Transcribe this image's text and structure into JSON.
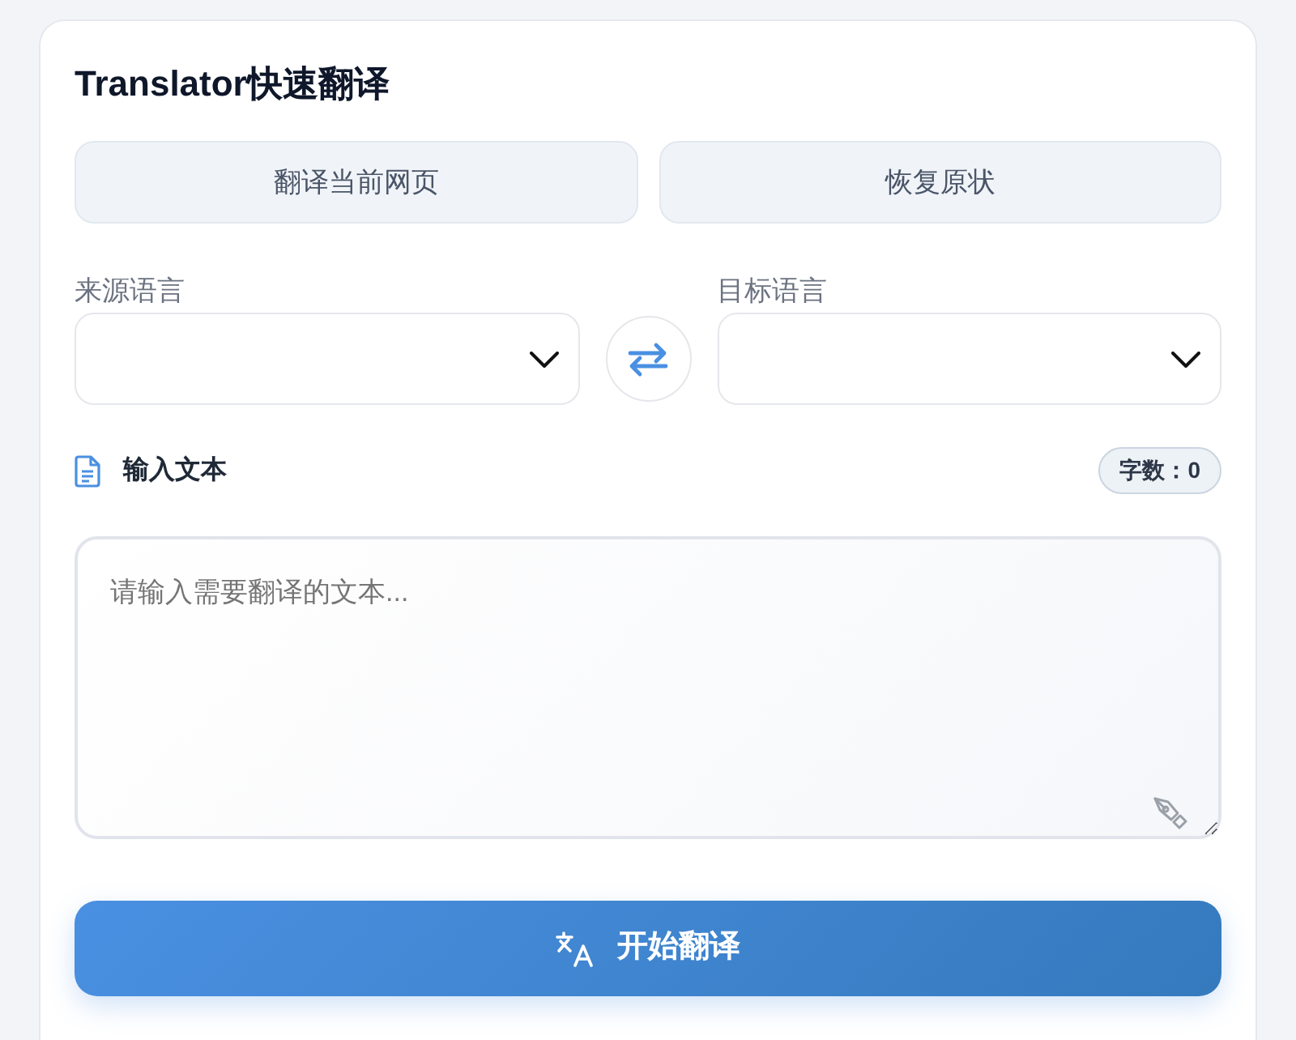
{
  "title": "Translator快速翻译",
  "actions": [
    {
      "label": "翻译当前网页"
    },
    {
      "label": "恢复原状"
    }
  ],
  "source_language": {
    "label": "来源语言"
  },
  "target_language": {
    "label": "目标语言"
  },
  "input": {
    "label": "输入文本",
    "count": "字数：0",
    "placeholder": "请输入需要翻译的文本..."
  },
  "submit": {
    "label": "开始翻译"
  }
}
